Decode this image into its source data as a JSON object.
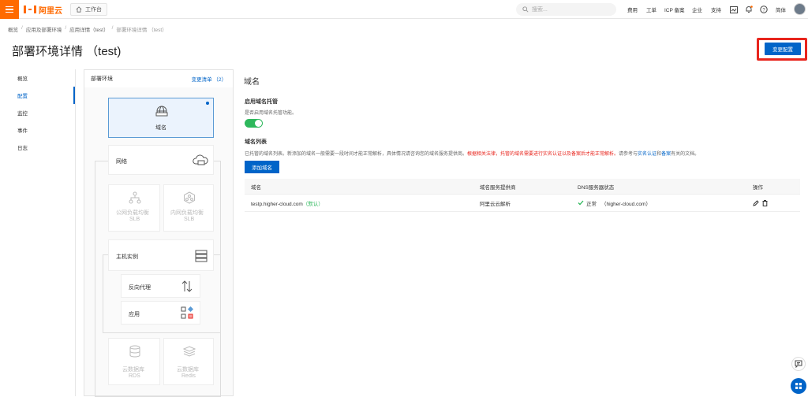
{
  "topbar": {
    "logo_text": "阿里云",
    "workbench_label": "工作台",
    "search_placeholder": "搜索...",
    "nav": [
      "费用",
      "工单",
      "ICP 备案",
      "企业",
      "支持"
    ],
    "lang": "简体",
    "accent": "#ff6a00"
  },
  "breadcrumb": [
    "概览",
    "应用及部署环境",
    "应用详情（test）",
    "部署环境详情 （test）"
  ],
  "page": {
    "title": "部署环境详情 （test)",
    "change_button": "变更配置",
    "primary_color": "#0064c8"
  },
  "leftnav": {
    "items": [
      "概览",
      "配置",
      "监控",
      "事件",
      "日志"
    ],
    "active": "配置"
  },
  "env": {
    "header": "部署环境",
    "change_list": "变更清单 （2）",
    "domain_card": "域名",
    "network_group": "网络",
    "public_slb": [
      "公网负载均衡",
      "SLB"
    ],
    "private_slb": [
      "内网负载均衡",
      "SLB"
    ],
    "host_group": "主机实例",
    "reverse_proxy": "反向代理",
    "app": "应用",
    "rds": [
      "云数据库",
      "RDS"
    ],
    "redis": [
      "云数据库",
      "Redis"
    ]
  },
  "domain": {
    "section_title": "域名",
    "hosting_label": "启用域名托管",
    "hosting_desc": "是否启用域名托管功能。",
    "hosting_enabled": true,
    "list_label": "域名列表",
    "list_desc_1": "已托管的域名列表。新添加的域名一般需要一段时间才能正常解析，具体情况请咨询您的域名服务提供商。",
    "list_desc_red": "根据相关法律，托管的域名需要进行实名认证以及备案后才能正常解析。",
    "list_desc_2": "请参考与",
    "list_desc_link1": "实名认证",
    "list_desc_and": "和",
    "list_desc_link2": "备案",
    "list_desc_3": "有关的文档。",
    "add_button": "添加域名",
    "table": {
      "headers": [
        "域名",
        "域名服务提供商",
        "DNS服务器状态",
        "操作"
      ],
      "rows": [
        {
          "domain": "testp.higher-cloud.com",
          "default_tag": "（默认）",
          "provider": "阿里云云解析",
          "status_text": "正常",
          "status_detail": "（higher-cloud.com）"
        }
      ]
    }
  }
}
